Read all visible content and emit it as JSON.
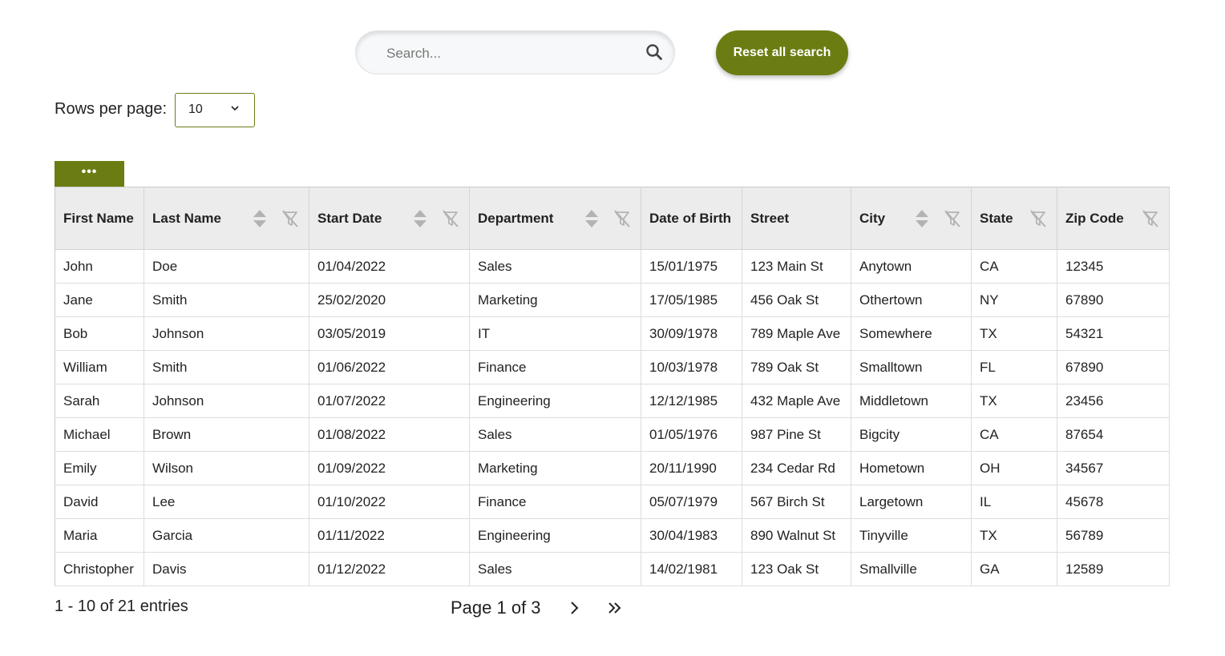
{
  "search": {
    "placeholder": "Search...",
    "value": "",
    "icon": "search-icon"
  },
  "reset_button": {
    "label": "Reset all search"
  },
  "rows_per_page": {
    "label": "Rows per page:",
    "selected": "10"
  },
  "toolbar": {
    "more_label": "•••"
  },
  "table": {
    "columns": [
      {
        "label": "First Name",
        "sortable": false,
        "filterable": false
      },
      {
        "label": "Last Name",
        "sortable": true,
        "filterable": true
      },
      {
        "label": "Start Date",
        "sortable": true,
        "filterable": true
      },
      {
        "label": "Department",
        "sortable": true,
        "filterable": true
      },
      {
        "label": "Date of Birth",
        "sortable": false,
        "filterable": false
      },
      {
        "label": "Street",
        "sortable": false,
        "filterable": false
      },
      {
        "label": "City",
        "sortable": true,
        "filterable": true
      },
      {
        "label": "State",
        "sortable": false,
        "filterable": true
      },
      {
        "label": "Zip Code",
        "sortable": false,
        "filterable": true
      }
    ],
    "rows": [
      [
        "John",
        "Doe",
        "01/04/2022",
        "Sales",
        "15/01/1975",
        "123 Main St",
        "Anytown",
        "CA",
        "12345"
      ],
      [
        "Jane",
        "Smith",
        "25/02/2020",
        "Marketing",
        "17/05/1985",
        "456 Oak St",
        "Othertown",
        "NY",
        "67890"
      ],
      [
        "Bob",
        "Johnson",
        "03/05/2019",
        "IT",
        "30/09/1978",
        "789 Maple Ave",
        "Somewhere",
        "TX",
        "54321"
      ],
      [
        "William",
        "Smith",
        "01/06/2022",
        "Finance",
        "10/03/1978",
        "789 Oak St",
        "Smalltown",
        "FL",
        "67890"
      ],
      [
        "Sarah",
        "Johnson",
        "01/07/2022",
        "Engineering",
        "12/12/1985",
        "432 Maple Ave",
        "Middletown",
        "TX",
        "23456"
      ],
      [
        "Michael",
        "Brown",
        "01/08/2022",
        "Sales",
        "01/05/1976",
        "987 Pine St",
        "Bigcity",
        "CA",
        "87654"
      ],
      [
        "Emily",
        "Wilson",
        "01/09/2022",
        "Marketing",
        "20/11/1990",
        "234 Cedar Rd",
        "Hometown",
        "OH",
        "34567"
      ],
      [
        "David",
        "Lee",
        "01/10/2022",
        "Finance",
        "05/07/1979",
        "567 Birch St",
        "Largetown",
        "IL",
        "45678"
      ],
      [
        "Maria",
        "Garcia",
        "01/11/2022",
        "Engineering",
        "30/04/1983",
        "890 Walnut St",
        "Tinyville",
        "TX",
        "56789"
      ],
      [
        "Christopher",
        "Davis",
        "01/12/2022",
        "Sales",
        "14/02/1981",
        "123 Oak St",
        "Smallville",
        "GA",
        "12589"
      ]
    ]
  },
  "pagination": {
    "entries_text": "1 - 10 of 21 entries",
    "page_text": "Page 1 of 3",
    "next_icon": "chevron-right-icon",
    "last_icon": "double-chevron-right-icon"
  },
  "colors": {
    "accent": "#6b7d12",
    "header_bg": "#ececec",
    "icon_gray": "#b3b3b3"
  }
}
